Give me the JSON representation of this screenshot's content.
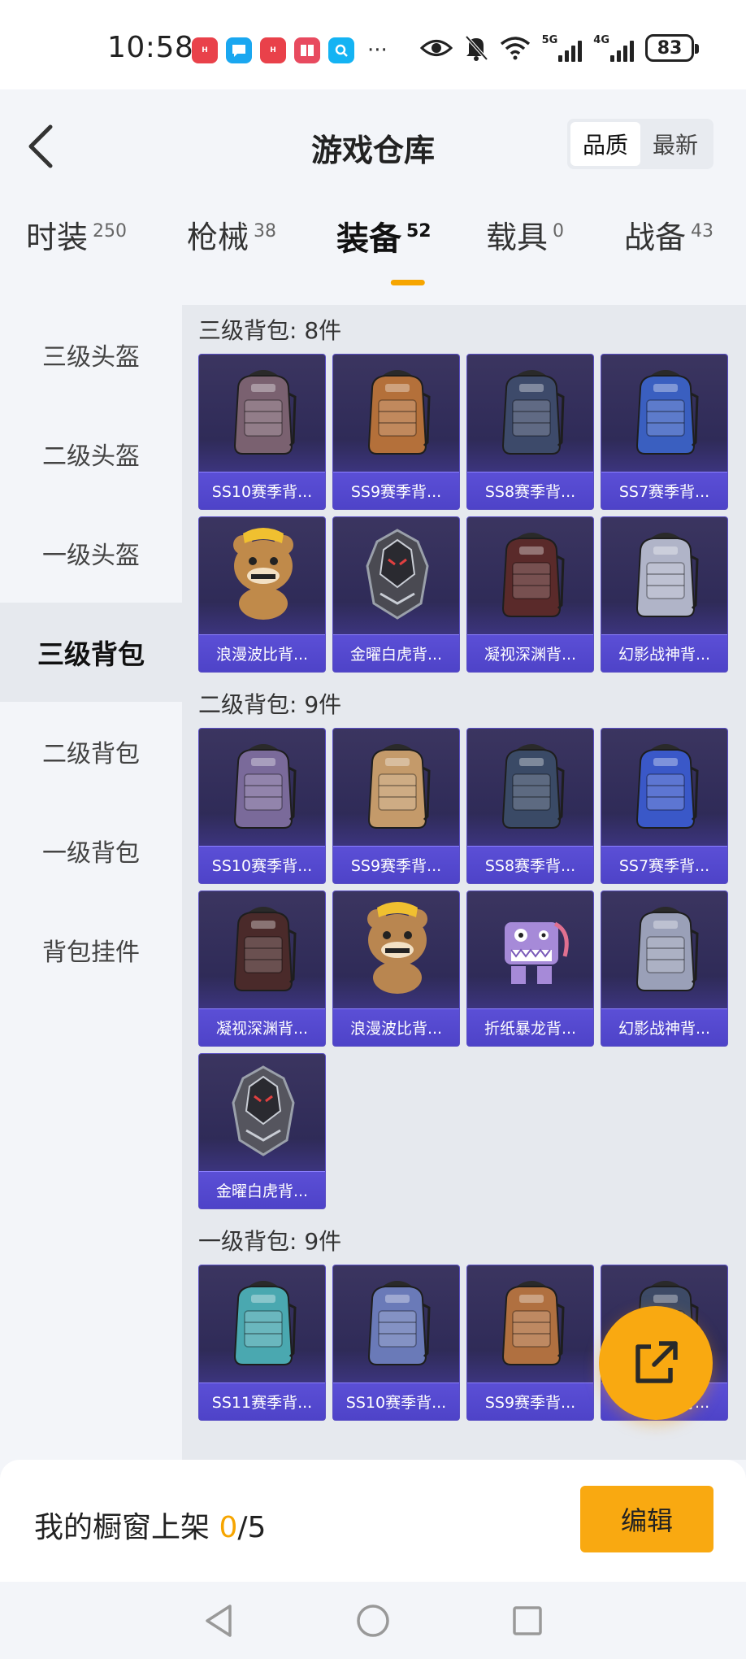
{
  "status_bar": {
    "time": "10:58",
    "network_labels": [
      "5G",
      "4G"
    ],
    "battery": "83"
  },
  "header": {
    "title": "游戏仓库",
    "sort_options": [
      "品质",
      "最新"
    ],
    "active_sort": "品质"
  },
  "category_tabs": [
    {
      "label": "时装",
      "count": "250"
    },
    {
      "label": "枪械",
      "count": "38"
    },
    {
      "label": "装备",
      "count": "52"
    },
    {
      "label": "载具",
      "count": "0"
    },
    {
      "label": "战备",
      "count": "43"
    }
  ],
  "active_category": "装备",
  "sidebar": {
    "items": [
      "三级头盔",
      "二级头盔",
      "一级头盔",
      "三级背包",
      "二级背包",
      "一级背包",
      "背包挂件"
    ],
    "active": "三级背包"
  },
  "sections": [
    {
      "title": "三级背包: 8件",
      "items": [
        {
          "name": "SS10赛季背...",
          "icon": "backpack-icon",
          "color": "#7a6170"
        },
        {
          "name": "SS9赛季背...",
          "icon": "backpack-icon",
          "color": "#b4703a"
        },
        {
          "name": "SS8赛季背...",
          "icon": "backpack-icon",
          "color": "#3d4a6a"
        },
        {
          "name": "SS7赛季背...",
          "icon": "backpack-icon",
          "color": "#3a5fc0"
        },
        {
          "name": "浪漫波比背...",
          "icon": "bear-backpack-icon",
          "color": "#c08a4a"
        },
        {
          "name": "金曜白虎背...",
          "icon": "armor-backpack-icon",
          "color": "#4a4a52"
        },
        {
          "name": "凝视深渊背...",
          "icon": "backpack-icon",
          "color": "#5a2a2a"
        },
        {
          "name": "幻影战神背...",
          "icon": "backpack-icon",
          "color": "#b0b4c8"
        }
      ]
    },
    {
      "title": "二级背包: 9件",
      "items": [
        {
          "name": "SS10赛季背...",
          "icon": "backpack-icon",
          "color": "#7a6a9a"
        },
        {
          "name": "SS9赛季背...",
          "icon": "backpack-icon",
          "color": "#c49a6a"
        },
        {
          "name": "SS8赛季背...",
          "icon": "backpack-icon",
          "color": "#3a4a66"
        },
        {
          "name": "SS7赛季背...",
          "icon": "backpack-icon",
          "color": "#3a58c8"
        },
        {
          "name": "凝视深渊背...",
          "icon": "backpack-icon",
          "color": "#4a2a2a"
        },
        {
          "name": "浪漫波比背...",
          "icon": "bear-backpack-icon",
          "color": "#b98650"
        },
        {
          "name": "折纸暴龙背...",
          "icon": "dino-backpack-icon",
          "color": "#a68ad8"
        },
        {
          "name": "幻影战神背...",
          "icon": "backpack-icon",
          "color": "#9aa0b8"
        },
        {
          "name": "金曜白虎背...",
          "icon": "armor-backpack-icon",
          "color": "#55555e"
        }
      ]
    },
    {
      "title": "一级背包: 9件",
      "items": [
        {
          "name": "SS11赛季背...",
          "icon": "backpack-icon",
          "color": "#4aa8b0"
        },
        {
          "name": "SS10赛季背...",
          "icon": "backpack-icon",
          "color": "#6a7ab8"
        },
        {
          "name": "SS9赛季背...",
          "icon": "backpack-icon",
          "color": "#b07040"
        },
        {
          "name": "SS8赛季背...",
          "icon": "backpack-icon",
          "color": "#3d4a66"
        }
      ]
    }
  ],
  "bottom_bar": {
    "label": "我的橱窗上架 ",
    "current": "0",
    "total": "/5",
    "edit_label": "编辑"
  },
  "colors": {
    "accent": "#f9a911",
    "card_bg": "#2f2b58",
    "card_label_bg": "#4e43c8"
  }
}
